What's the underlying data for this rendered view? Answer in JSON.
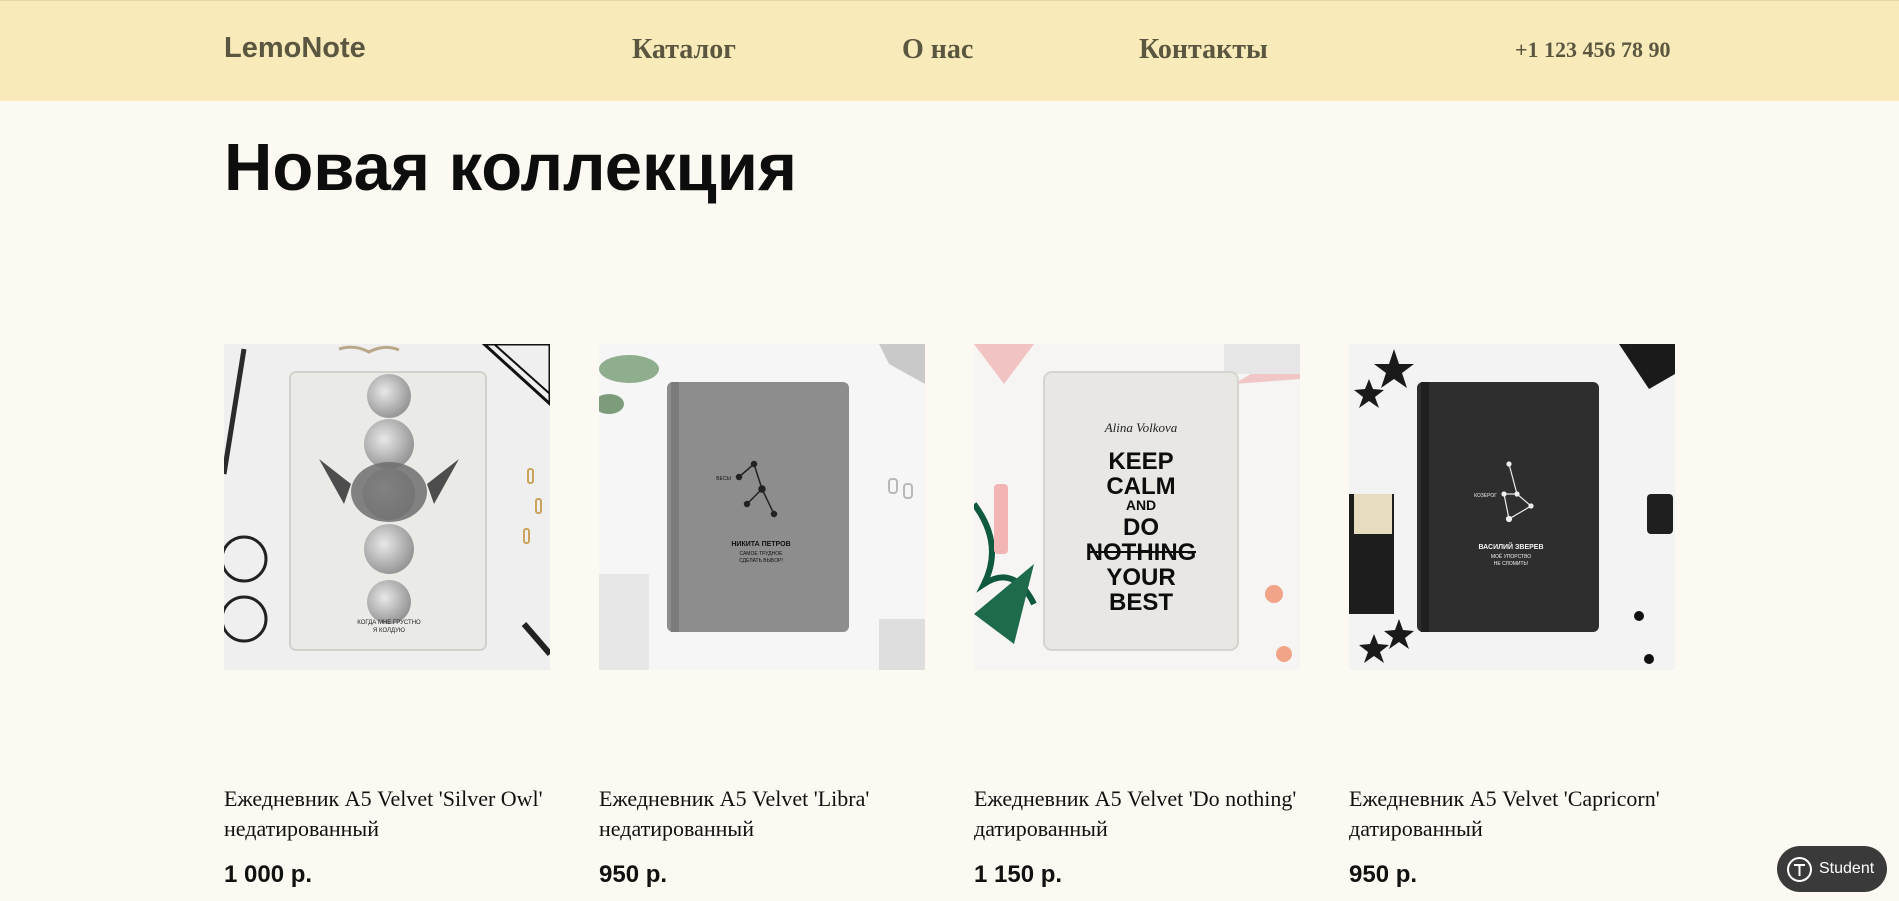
{
  "header": {
    "logo": "LemoNote",
    "nav": [
      "Каталог",
      "О нас",
      "Контакты"
    ],
    "phone": "+1 123 456 78 90"
  },
  "title": "Новая коллекция",
  "products": [
    {
      "name": "Ежедневник А5 Velvet 'Silver Owl' недатированный",
      "price": "1 000 р.",
      "cover_text": "КОГДА МНЕ ГРУСТНО Я КОЛДУЮ"
    },
    {
      "name": "Ежедневник А5 Velvet 'Libra' недатированный",
      "price": "950 р.",
      "cover_text": {
        "sign": "ВЕСЫ",
        "name": "НИКИТА ПЕТРОВ",
        "line1": "САМОЕ ТРУДНОЕ",
        "line2": "СДЕЛАТЬ ВЫБОР!"
      }
    },
    {
      "name": "Ежедневник А5 Velvet 'Do nothing' датированный",
      "price": "1 150 р.",
      "cover_text": {
        "signature": "Alina Volkova",
        "lines": [
          "KEEP",
          "CALM",
          "AND",
          "DO",
          "NOTHING",
          "YOUR",
          "BEST"
        ]
      }
    },
    {
      "name": "Ежедневник А5 Velvet 'Capricorn' датированный",
      "price": "950 р.",
      "cover_text": {
        "sign": "КОЗЕРОГ",
        "name": "ВАСИЛИЙ ЗВЕРЕВ",
        "line1": "МОЁ УПОРСТВО",
        "line2": "НЕ СЛОМИТЬ!"
      }
    }
  ],
  "badge": {
    "label": "Student"
  }
}
